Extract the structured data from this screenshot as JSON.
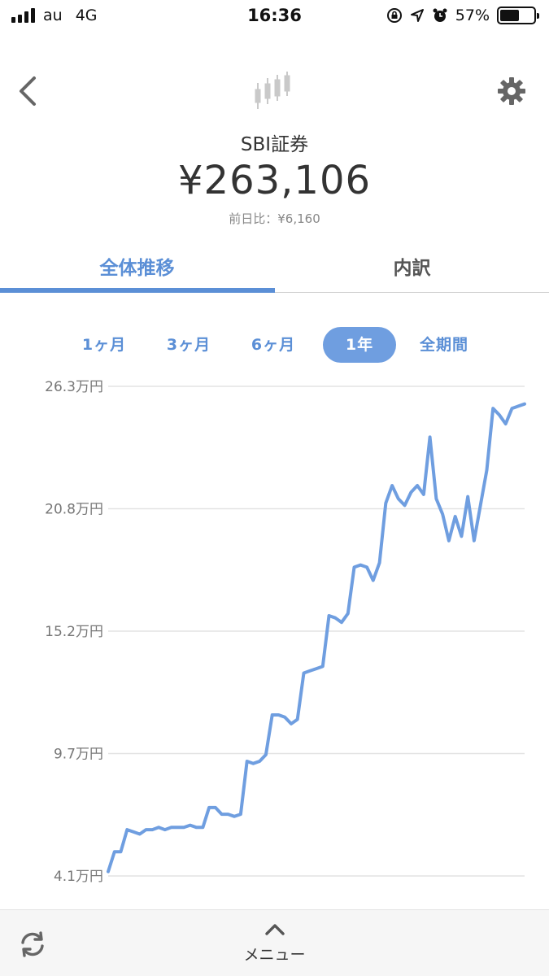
{
  "status_bar": {
    "carrier": "au",
    "network": "4G",
    "time": "16:36",
    "battery_percent": "57%",
    "battery_level": 0.57
  },
  "header": {
    "account_name": "SBI証券",
    "total_value": "¥263,106",
    "day_diff": "前日比：¥6,160"
  },
  "tabs": [
    {
      "label": "全体推移",
      "active": true
    },
    {
      "label": "内訳",
      "active": false
    }
  ],
  "periods": [
    {
      "label": "1ヶ月",
      "selected": false
    },
    {
      "label": "3ヶ月",
      "selected": false
    },
    {
      "label": "6ヶ月",
      "selected": false
    },
    {
      "label": "1年",
      "selected": true
    },
    {
      "label": "全期間",
      "selected": false
    }
  ],
  "bottom_bar": {
    "menu_label": "メニュー"
  },
  "colors": {
    "accent": "#5b8fd6",
    "line": "#6f9ee0",
    "grid": "#e3e3e3"
  },
  "chart_data": {
    "type": "line",
    "ytick_labels": [
      "26.3万円",
      "20.8万円",
      "15.2万円",
      "9.7万円",
      "4.1万円"
    ],
    "ylim": [
      4.1,
      26.3
    ],
    "grid": true,
    "series": [
      {
        "values": [
          4.3,
          5.2,
          5.2,
          6.2,
          6.1,
          6.0,
          6.2,
          6.2,
          6.3,
          6.2,
          6.3,
          6.3,
          6.3,
          6.4,
          6.3,
          6.3,
          7.2,
          7.2,
          6.9,
          6.9,
          6.8,
          6.9,
          9.3,
          9.2,
          9.3,
          9.6,
          11.4,
          11.4,
          11.3,
          11.0,
          11.2,
          13.3,
          13.4,
          13.5,
          13.6,
          15.9,
          15.8,
          15.6,
          16.0,
          18.1,
          18.2,
          18.1,
          17.5,
          18.3,
          21.0,
          21.8,
          21.2,
          20.9,
          21.5,
          21.8,
          21.4,
          24.0,
          21.2,
          20.5,
          19.3,
          20.4,
          19.5,
          21.3,
          19.3,
          20.9,
          22.5,
          25.3,
          25.0,
          24.6,
          25.3,
          25.4,
          25.5
        ]
      }
    ]
  }
}
